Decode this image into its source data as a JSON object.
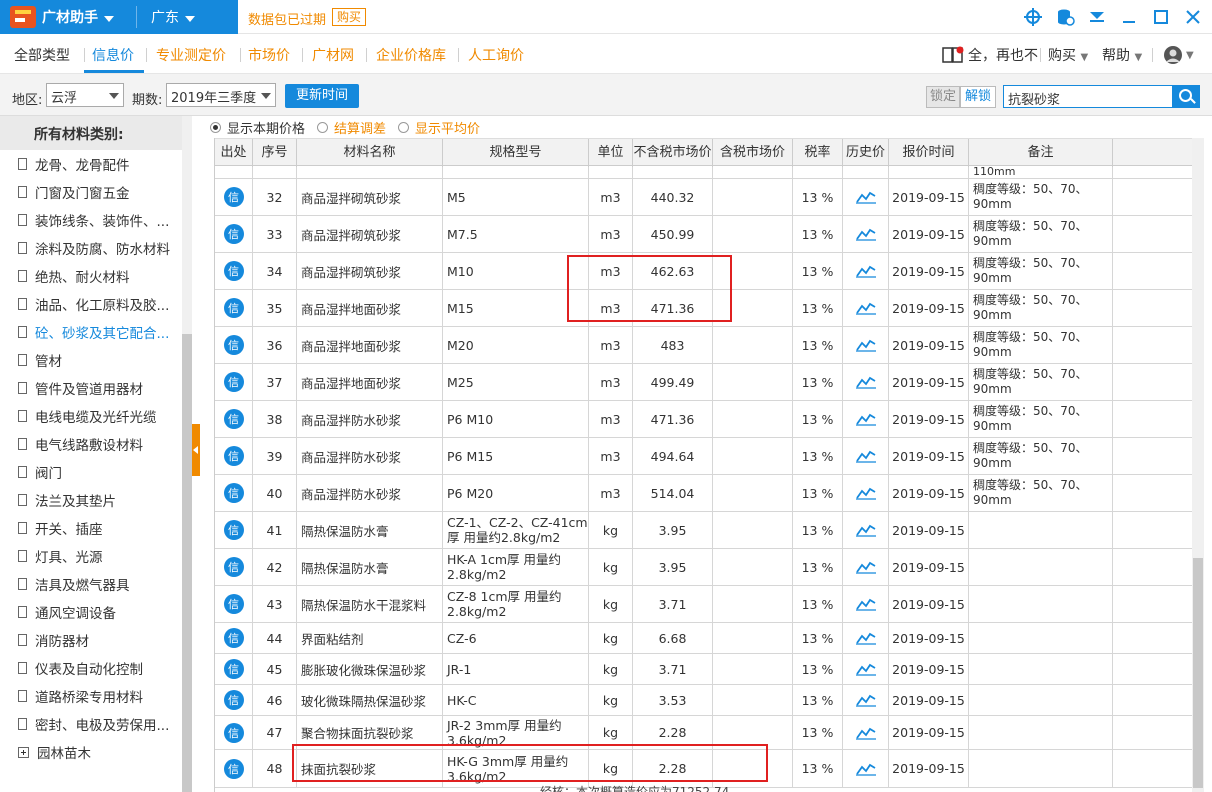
{
  "titlebar": {
    "app_name": "广材助手",
    "province": "广东",
    "expired_text": "数据包已过期",
    "buy_label": "购买"
  },
  "nav": {
    "tabs": [
      "全部类型",
      "信息价",
      "专业测定价",
      "市场价",
      "广材网",
      "企业价格库",
      "人工询价"
    ],
    "active_tab": "信息价",
    "user_text": "全，再也不",
    "buy_menu": "购买",
    "help_menu": "帮助"
  },
  "filter": {
    "region_label": "地区:",
    "region_value": "云浮",
    "period_label": "期数:",
    "period_value": "2019年三季度",
    "update_button": "更新时间",
    "lock_button": "锁定",
    "unlock_button": "解锁",
    "search_value": "抗裂砂浆"
  },
  "sidebar": {
    "title": "所有材料类别:",
    "items": [
      "龙骨、龙骨配件",
      "门窗及门窗五金",
      "装饰线条、装饰件、...",
      "涂料及防腐、防水材料",
      "绝热、耐火材料",
      "油品、化工原料及胶...",
      "砼、砂浆及其它配合...",
      "管材",
      "管件及管道用器材",
      "电线电缆及光纤光缆",
      "电气线路敷设材料",
      "阀门",
      "法兰及其垫片",
      "开关、插座",
      "灯具、光源",
      "洁具及燃气器具",
      "通风空调设备",
      "消防器材",
      "仪表及自动化控制",
      "道路桥梁专用材料",
      "密封、电极及劳保用...",
      "园林苗木"
    ],
    "active_index": 6
  },
  "price_options": [
    "显示本期价格",
    "结算调差",
    "显示平均价"
  ],
  "table": {
    "headers": [
      "出处",
      "序号",
      "材料名称",
      "规格型号",
      "单位",
      "不含税市场价",
      "含税市场价",
      "税率",
      "历史价",
      "报价时间",
      "备注"
    ],
    "source_badge": "信",
    "top_partial_note": "110mm",
    "rows": [
      {
        "no": "32",
        "name": "商品湿拌砌筑砂浆",
        "spec": "M5",
        "unit": "m3",
        "price": "440.32",
        "tax_price": "",
        "rate": "13 %",
        "date": "2019-09-15",
        "note": "稠度等级：50、70、\n90mm"
      },
      {
        "no": "33",
        "name": "商品湿拌砌筑砂浆",
        "spec": "M7.5",
        "unit": "m3",
        "price": "450.99",
        "tax_price": "",
        "rate": "13 %",
        "date": "2019-09-15",
        "note": "稠度等级：50、70、\n90mm"
      },
      {
        "no": "34",
        "name": "商品湿拌砌筑砂浆",
        "spec": "M10",
        "unit": "m3",
        "price": "462.63",
        "tax_price": "",
        "rate": "13 %",
        "date": "2019-09-15",
        "note": "稠度等级：50、70、\n90mm"
      },
      {
        "no": "35",
        "name": "商品湿拌地面砂浆",
        "spec": "M15",
        "unit": "m3",
        "price": "471.36",
        "tax_price": "",
        "rate": "13 %",
        "date": "2019-09-15",
        "note": "稠度等级：50、70、\n90mm"
      },
      {
        "no": "36",
        "name": "商品湿拌地面砂浆",
        "spec": "M20",
        "unit": "m3",
        "price": "483",
        "tax_price": "",
        "rate": "13 %",
        "date": "2019-09-15",
        "note": "稠度等级：50、70、\n90mm"
      },
      {
        "no": "37",
        "name": "商品湿拌地面砂浆",
        "spec": "M25",
        "unit": "m3",
        "price": "499.49",
        "tax_price": "",
        "rate": "13 %",
        "date": "2019-09-15",
        "note": "稠度等级：50、70、\n90mm"
      },
      {
        "no": "38",
        "name": "商品湿拌防水砂浆",
        "spec": "P6 M10",
        "unit": "m3",
        "price": "471.36",
        "tax_price": "",
        "rate": "13 %",
        "date": "2019-09-15",
        "note": "稠度等级：50、70、\n90mm"
      },
      {
        "no": "39",
        "name": "商品湿拌防水砂浆",
        "spec": "P6 M15",
        "unit": "m3",
        "price": "494.64",
        "tax_price": "",
        "rate": "13 %",
        "date": "2019-09-15",
        "note": "稠度等级：50、70、\n90mm"
      },
      {
        "no": "40",
        "name": "商品湿拌防水砂浆",
        "spec": "P6 M20",
        "unit": "m3",
        "price": "514.04",
        "tax_price": "",
        "rate": "13 %",
        "date": "2019-09-15",
        "note": "稠度等级：50、70、\n90mm"
      },
      {
        "no": "41",
        "name": "隔热保温防水膏",
        "spec": "CZ-1、CZ-2、CZ-41cm\n厚 用量约2.8kg/m2",
        "unit": "kg",
        "price": "3.95",
        "tax_price": "",
        "rate": "13 %",
        "date": "2019-09-15",
        "note": ""
      },
      {
        "no": "42",
        "name": "隔热保温防水膏",
        "spec": "HK-A 1cm厚 用量约\n2.8kg/m2",
        "unit": "kg",
        "price": "3.95",
        "tax_price": "",
        "rate": "13 %",
        "date": "2019-09-15",
        "note": ""
      },
      {
        "no": "43",
        "name": "隔热保温防水干混浆料",
        "spec": "CZ-8 1cm厚 用量约\n2.8kg/m2",
        "unit": "kg",
        "price": "3.71",
        "tax_price": "",
        "rate": "13 %",
        "date": "2019-09-15",
        "note": ""
      },
      {
        "no": "44",
        "name": "界面粘结剂",
        "spec": "CZ-6",
        "unit": "kg",
        "price": "6.68",
        "tax_price": "",
        "rate": "13 %",
        "date": "2019-09-15",
        "note": ""
      },
      {
        "no": "45",
        "name": "膨胀玻化微珠保温砂浆",
        "spec": "JR-1",
        "unit": "kg",
        "price": "3.71",
        "tax_price": "",
        "rate": "13 %",
        "date": "2019-09-15",
        "note": ""
      },
      {
        "no": "46",
        "name": "玻化微珠隔热保温砂浆",
        "spec": "HK-C",
        "unit": "kg",
        "price": "3.53",
        "tax_price": "",
        "rate": "13 %",
        "date": "2019-09-15",
        "note": ""
      },
      {
        "no": "47",
        "name": "聚合物抹面抗裂砂浆",
        "spec": "JR-2 3mm厚 用量约\n3.6kg/m2",
        "unit": "kg",
        "price": "2.28",
        "tax_price": "",
        "rate": "13 %",
        "date": "2019-09-15",
        "note": ""
      },
      {
        "no": "48",
        "name": "抹面抗裂砂浆",
        "spec": "HK-G 3mm厚 用量约\n3.6kg/m2",
        "unit": "kg",
        "price": "2.28",
        "tax_price": "",
        "rate": "13 %",
        "date": "2019-09-15",
        "note": ""
      }
    ]
  },
  "bottom_partial_text": "经核：本次概算造价应为71252.74",
  "colors": {
    "brand_blue": "#1589dc",
    "accent_orange": "#f08a00",
    "highlight_red": "#e02020"
  }
}
